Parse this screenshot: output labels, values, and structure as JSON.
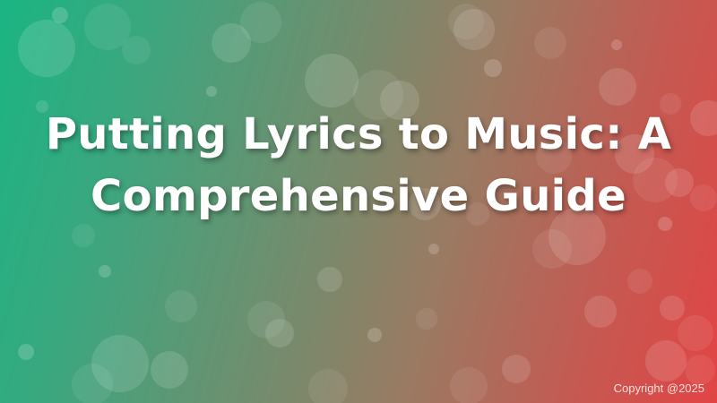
{
  "title": "Putting Lyrics to Music: A Comprehensive Guide",
  "copyright": "Copyright @2025",
  "colors": {
    "gradient_start": "#1bb583",
    "gradient_end": "#e24444",
    "text": "#ffffff"
  }
}
